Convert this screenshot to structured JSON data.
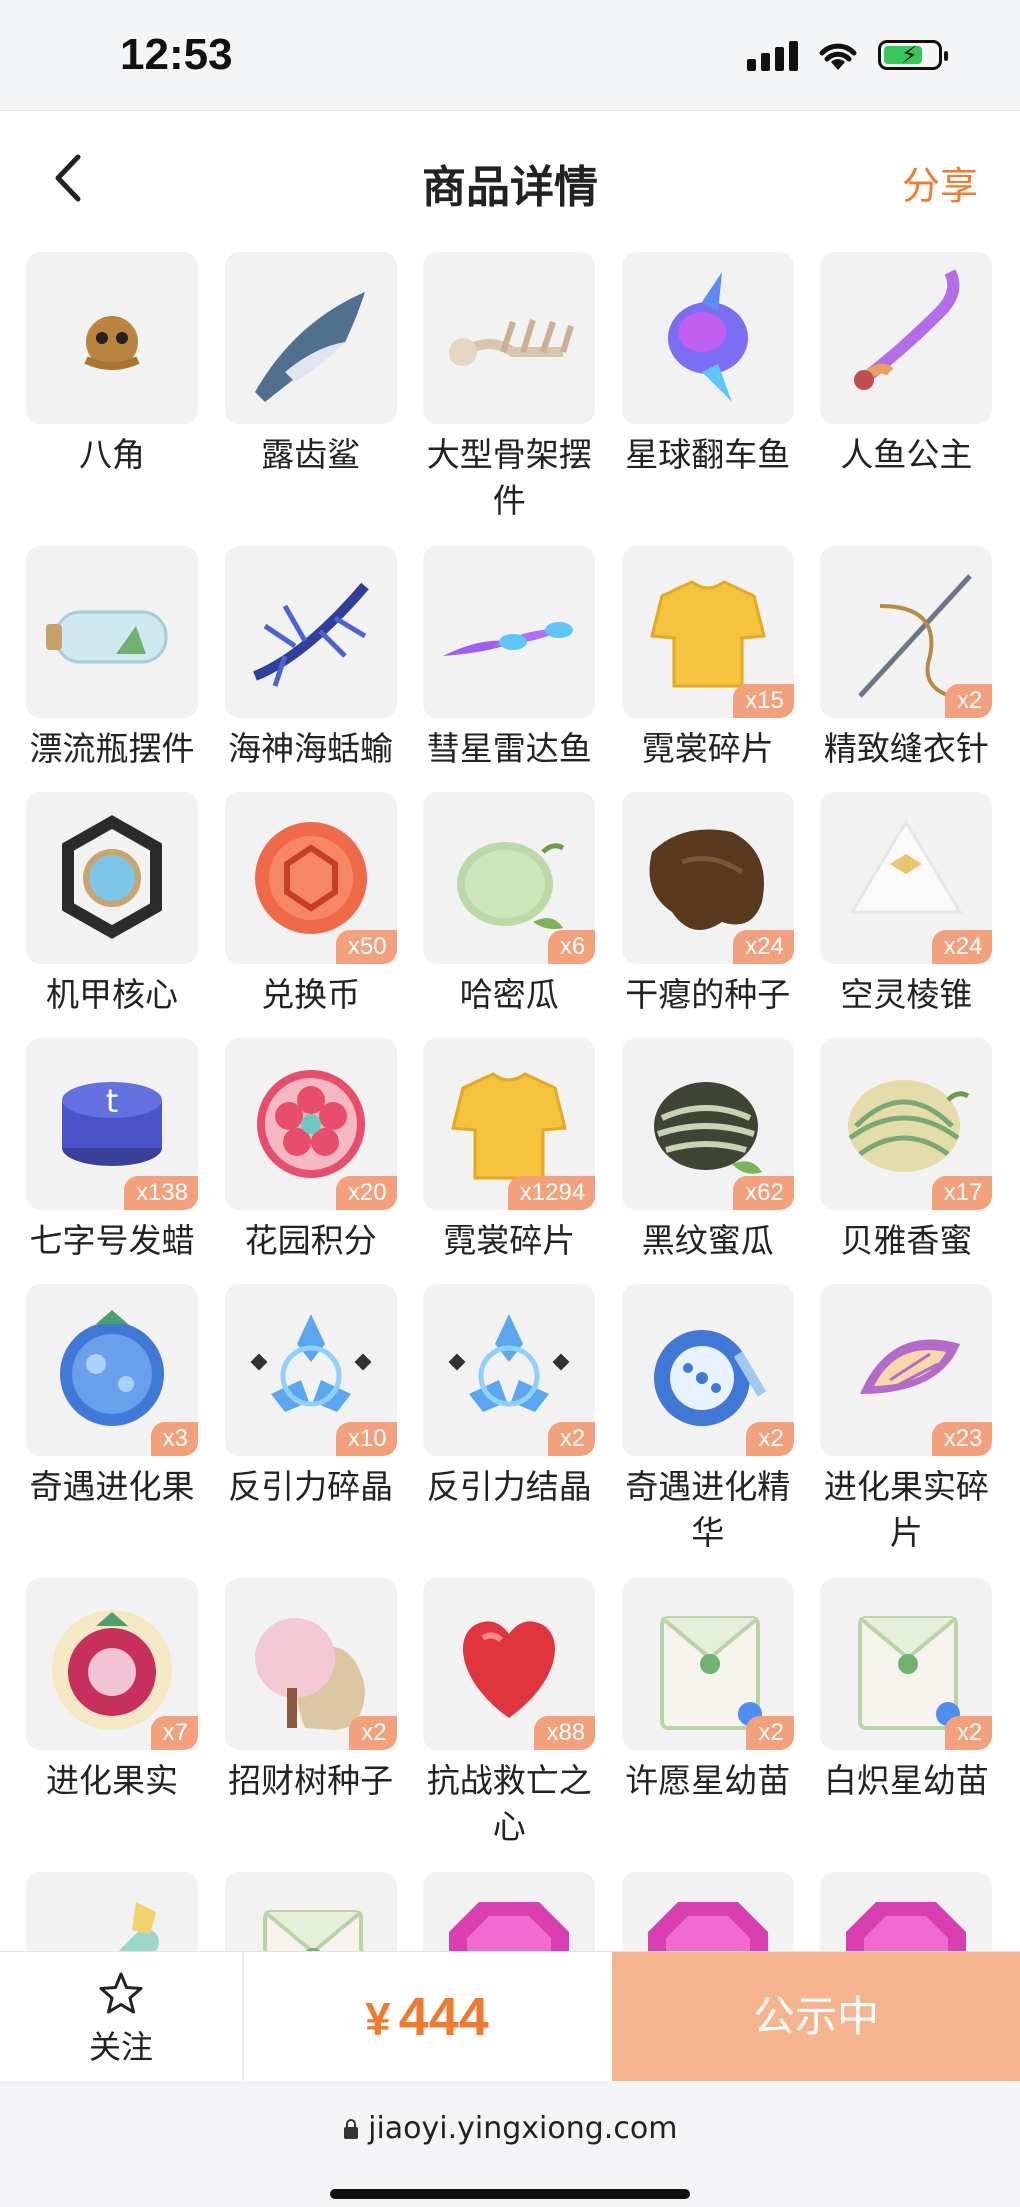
{
  "status_bar": {
    "time": "12:53"
  },
  "nav": {
    "title": "商品详情",
    "share": "分享"
  },
  "items": [
    {
      "name": "八角",
      "count": "",
      "art": "octopus-plush"
    },
    {
      "name": "露齿鲨",
      "count": "",
      "art": "shark"
    },
    {
      "name": "大型骨架摆件",
      "count": "",
      "art": "skeleton"
    },
    {
      "name": "星球翻车鱼",
      "count": "",
      "art": "sunfish"
    },
    {
      "name": "人鱼公主",
      "count": "",
      "art": "mermaid"
    },
    {
      "name": "漂流瓶摆件",
      "count": "",
      "art": "bottle"
    },
    {
      "name": "海神海蛞蝓",
      "count": "",
      "art": "sea-slug"
    },
    {
      "name": "彗星雷达鱼",
      "count": "",
      "art": "comet-fish"
    },
    {
      "name": "霓裳碎片",
      "count": "x15",
      "art": "shirt"
    },
    {
      "name": "精致缝衣针",
      "count": "x2",
      "art": "needle"
    },
    {
      "name": "机甲核心",
      "count": "",
      "art": "mech-core"
    },
    {
      "name": "兑换币",
      "count": "x50",
      "art": "coin"
    },
    {
      "name": "哈密瓜",
      "count": "x6",
      "art": "melon"
    },
    {
      "name": "干瘪的种子",
      "count": "x24",
      "art": "dry-seed"
    },
    {
      "name": "空灵棱锥",
      "count": "x24",
      "art": "pyramid"
    },
    {
      "name": "七字号发蜡",
      "count": "x138",
      "art": "wax"
    },
    {
      "name": "花园积分",
      "count": "x20",
      "art": "flower-badge"
    },
    {
      "name": "霓裳碎片",
      "count": "x1294",
      "art": "shirt"
    },
    {
      "name": "黑纹蜜瓜",
      "count": "x62",
      "art": "striped-melon"
    },
    {
      "name": "贝雅香蜜",
      "count": "x17",
      "art": "melon-light"
    },
    {
      "name": "奇遇进化果",
      "count": "x3",
      "art": "blue-fruit"
    },
    {
      "name": "反引力碎晶",
      "count": "x10",
      "art": "crystal"
    },
    {
      "name": "反引力结晶",
      "count": "x2",
      "art": "crystal"
    },
    {
      "name": "奇遇进化精华",
      "count": "x2",
      "art": "blue-fruit-cut"
    },
    {
      "name": "进化果实碎片",
      "count": "x23",
      "art": "fruit-slice"
    },
    {
      "name": "进化果实",
      "count": "x7",
      "art": "red-fruit"
    },
    {
      "name": "招财树种子",
      "count": "x2",
      "art": "seed-sack"
    },
    {
      "name": "抗战救亡之心",
      "count": "x88",
      "art": "heart"
    },
    {
      "name": "许愿星幼苗",
      "count": "x2",
      "art": "seed-packet"
    },
    {
      "name": "白炽星幼苗",
      "count": "x2",
      "art": "seed-packet"
    },
    {
      "name": "",
      "count": "",
      "art": "potion"
    },
    {
      "name": "",
      "count": "",
      "art": "seed-packet"
    },
    {
      "name": "",
      "count": "",
      "art": "gem"
    },
    {
      "name": "",
      "count": "",
      "art": "gem"
    },
    {
      "name": "",
      "count": "",
      "art": "gem"
    }
  ],
  "bottom": {
    "follow": "关注",
    "currency": "¥",
    "price": "444",
    "status": "公示中"
  },
  "browser": {
    "url": "jiaoyi.yingxiong.com"
  },
  "colors": {
    "accent": "#f07b2e",
    "badge": "#f2a17c",
    "status_button": "#f5b48d"
  }
}
